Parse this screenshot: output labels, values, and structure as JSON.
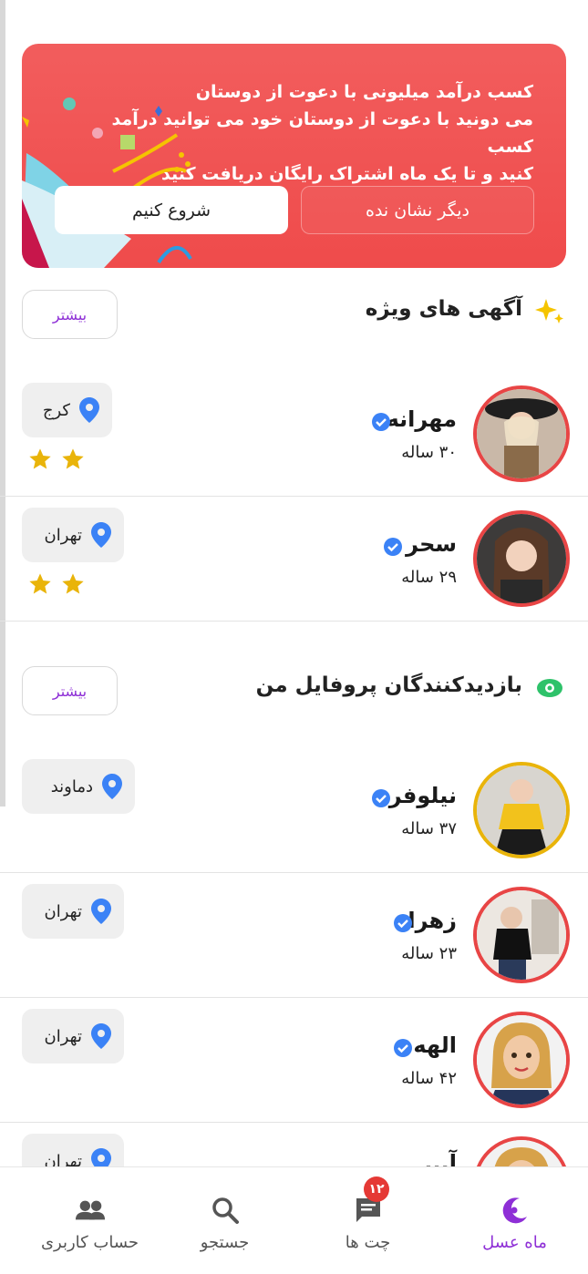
{
  "promo": {
    "lines": [
      "کسب درآمد میلیونی با دعوت از دوستان",
      "می دونید با دعوت از دوستان خود می توانید درآمد کسب",
      "کنید و تا یک ماه اشتراک رایگان دریافت کنید"
    ],
    "primary_button": "شروع کنیم",
    "secondary_button": "دیگر نشان نده"
  },
  "featured": {
    "title": "آگهی های ویژه",
    "more_label": "بیشتر",
    "icon": "sparkles-icon",
    "profiles": [
      {
        "name": "مهرانه",
        "age": "۳۰ ساله",
        "location": "کرج",
        "stars": 2
      },
      {
        "name": "سحر",
        "age": "۲۹ ساله",
        "location": "تهران",
        "stars": 2
      }
    ]
  },
  "visitors": {
    "title": "بازدیدکنندگان پروفایل من",
    "more_label": "بیشتر",
    "icon": "eye-icon",
    "profiles": [
      {
        "name": "نیلوفر",
        "age": "۳۷ ساله",
        "location": "دماوند"
      },
      {
        "name": "زهرا",
        "age": "۲۳ ساله",
        "location": "تهران"
      },
      {
        "name": "الهه",
        "age": "۴۲ ساله",
        "location": "تهران"
      },
      {
        "name": "آ...",
        "age": "",
        "location": "تهران"
      }
    ]
  },
  "bottom_nav": {
    "items": [
      {
        "label": "ماه عسل",
        "icon": "moon-icon",
        "active": true
      },
      {
        "label": "چت ها",
        "icon": "chat-icon",
        "badge": "۱۲"
      },
      {
        "label": "جستجو",
        "icon": "search-icon"
      },
      {
        "label": "حساب کاربری",
        "icon": "people-icon"
      }
    ]
  },
  "colors": {
    "accent": "#8e2fd6",
    "promo_red": "#ef4b4b",
    "verified_blue": "#3b82f6",
    "star_gold": "#e9b40a",
    "avatar_ring_red": "#e84545"
  }
}
